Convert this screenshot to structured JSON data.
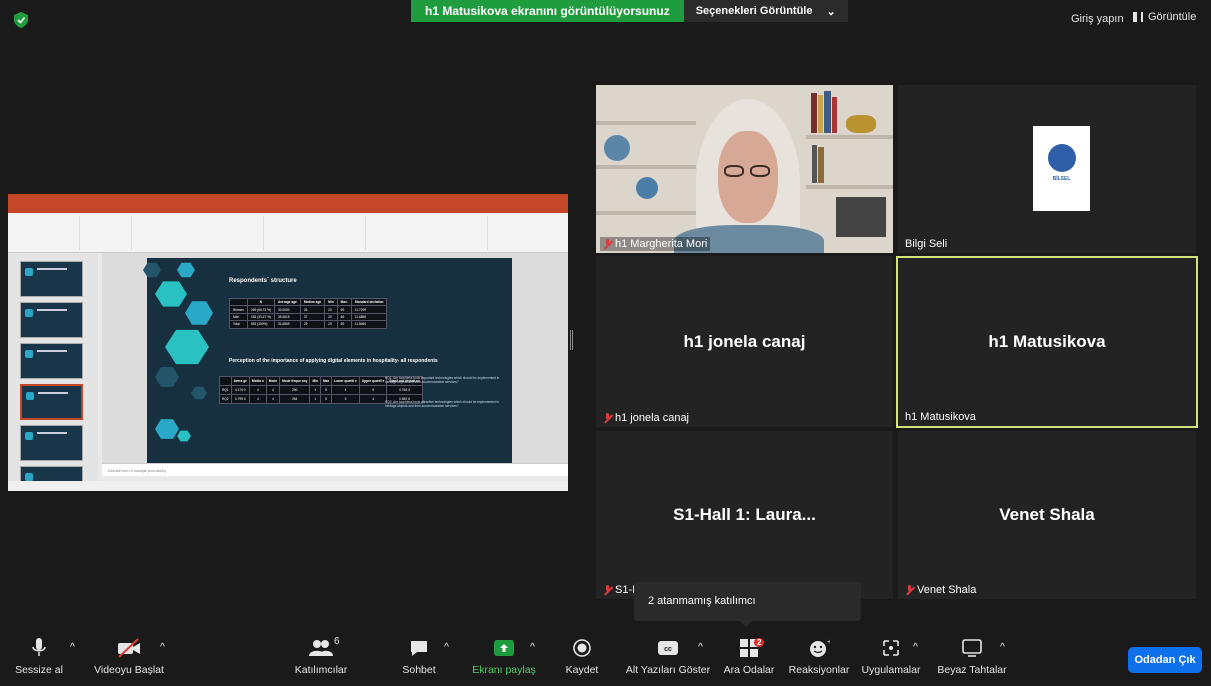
{
  "header": {
    "share_banner": "h1 Matusikova ekranını görüntülüyorsunuz",
    "view_options": "Seçenekleri Görüntüle",
    "signin": "Giriş yapın",
    "view": "Görüntüle"
  },
  "shared_screen": {
    "slide": {
      "title": "Respondents` structure",
      "table1": {
        "headers": [
          "",
          "N",
          "Average age",
          "Median age",
          "Min",
          "Max.",
          "Standard deviation"
        ],
        "rows": [
          [
            "Women",
            "269 (66.73 %)",
            "30.0000",
            "26",
            "20",
            "69",
            "11.7299"
          ],
          [
            "Men",
            "184 (33.27 %)",
            "35.0815",
            "37",
            "20",
            "66",
            "11.6856"
          ],
          [
            "Total",
            "553 (100%)",
            "31.6869",
            "29",
            "20",
            "69",
            "11.8460"
          ]
        ]
      },
      "subtitle": "Perception of the importance of applying digital elements in hospitality- all respondents",
      "table2": {
        "headers": [
          "",
          "Avera ge",
          "Media n",
          "Mode",
          "Mode freque ncy",
          "Min",
          "Max",
          "Lower quartil e",
          "Upper quartil e",
          "Stand ard deviati on"
        ],
        "rows": [
          [
            "RQ1",
            "4.170 0",
            "4",
            "4",
            "290",
            "1",
            "5",
            "4",
            "5",
            "0.763 3"
          ],
          [
            "RQ2",
            "3.799 3",
            "4",
            "4",
            "264",
            "1",
            "5",
            "3",
            "4",
            "0.862 6"
          ]
        ]
      },
      "rq1_note": "RQ1: Are touchless tools important technologies which should be implemented in heritage objects and their accommodation services?",
      "rq2_note": "RQ2: Are touchless tools attractive technologies which should be implemented in heritage objects and their accommodation services?"
    },
    "notes_placeholder": "Kliknite sem a zadajte poznámky"
  },
  "participants": {
    "margherita": "h1 Margherita Mori",
    "bilgi": "Bilgi Seli",
    "bilsel_logo_text": "BİLSEL",
    "jonela_big": "h1 jonela canaj",
    "jonela": "h1 jonela canaj",
    "matusikova_big": "h1 Matusikova",
    "matusikova": "h1 Matusikova",
    "laura_big": "S1-Hall 1: Laura...",
    "laura": "S1-I",
    "venet_big": "Venet Shala",
    "venet": "Venet Shala"
  },
  "tooltip": "2 atanmamış katılımcı",
  "toolbar": {
    "mute": "Sessize al",
    "video": "Videoyu Başlat",
    "participants": "Katılımcılar",
    "participants_count": "6",
    "chat": "Sohbet",
    "share": "Ekranı paylaş",
    "record": "Kaydet",
    "captions": "Alt Yazıları Göster",
    "breakout": "Ara Odalar",
    "breakout_badge": "2",
    "reactions": "Reaksiyonlar",
    "apps": "Uygulamalar",
    "whiteboard": "Beyaz Tahtalar",
    "leave": "Odadan Çık",
    "cc_icon_text": "cc"
  },
  "colors": {
    "share_green": "#1f9d3e",
    "active_speaker_border": "#d3e27a",
    "leave_blue": "#0e71eb",
    "badge_red": "#e02b2b"
  }
}
